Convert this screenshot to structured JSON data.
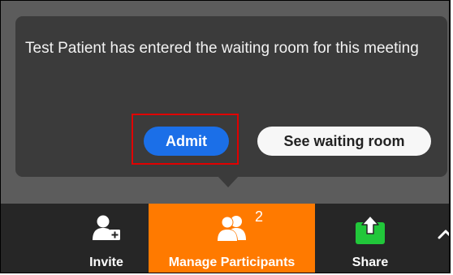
{
  "notification": {
    "message": "Test Patient has entered the waiting room for this meeting",
    "admit_label": "Admit",
    "see_waiting_room_label": "See waiting room"
  },
  "toolbar": {
    "items": [
      {
        "label": "Invite",
        "icon": "add-user-icon"
      },
      {
        "label": "Manage Participants",
        "icon": "participants-icon",
        "badge": "2"
      },
      {
        "label": "Share",
        "icon": "share-screen-icon"
      }
    ],
    "more_icon": "chevron-up-icon"
  },
  "colors": {
    "popup_bg": "#3b3b3b",
    "admit_button": "#1b6fe8",
    "highlight_border": "#e00000",
    "manage_participants_active": "#ff7a00",
    "share_icon": "#21c73a",
    "toolbar_bg": "#262626"
  }
}
